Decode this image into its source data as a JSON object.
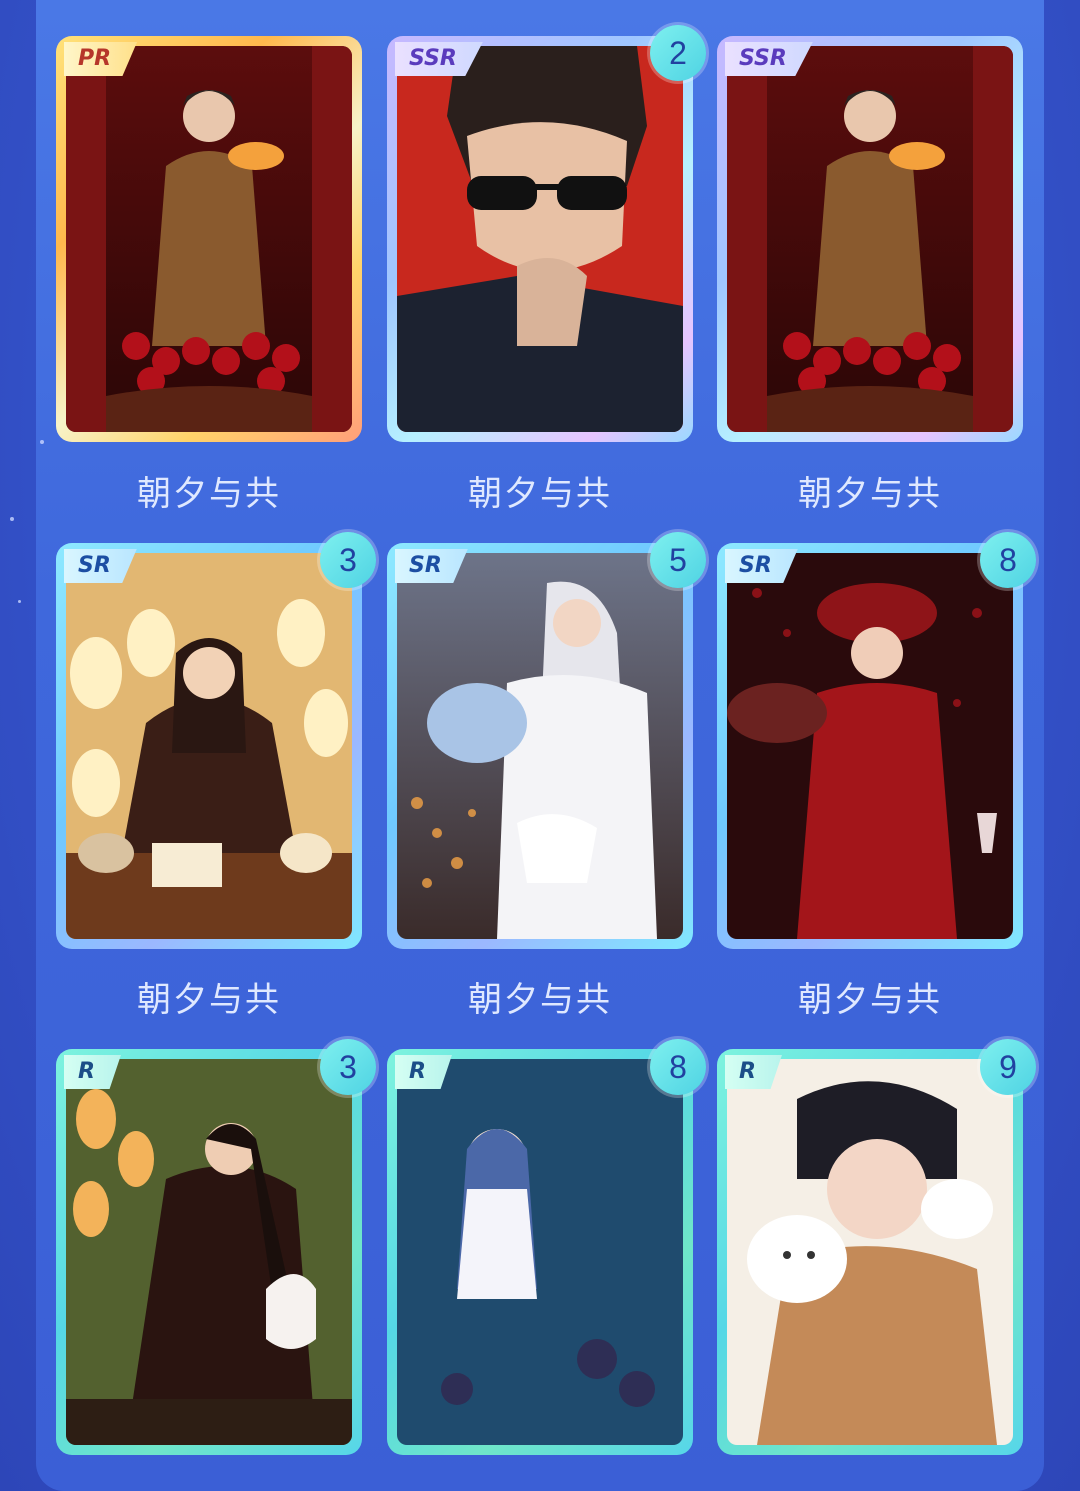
{
  "cards": [
    {
      "rarity": "PR",
      "count": "",
      "title": "朝夕与共"
    },
    {
      "rarity": "SSR",
      "count": "2",
      "title": "朝夕与共"
    },
    {
      "rarity": "SSR",
      "count": "",
      "title": "朝夕与共"
    },
    {
      "rarity": "SR",
      "count": "3",
      "title": "朝夕与共"
    },
    {
      "rarity": "SR",
      "count": "5",
      "title": "朝夕与共"
    },
    {
      "rarity": "SR",
      "count": "8",
      "title": "朝夕与共"
    },
    {
      "rarity": "R",
      "count": "3",
      "title": ""
    },
    {
      "rarity": "R",
      "count": "8",
      "title": ""
    },
    {
      "rarity": "R",
      "count": "9",
      "title": ""
    }
  ]
}
